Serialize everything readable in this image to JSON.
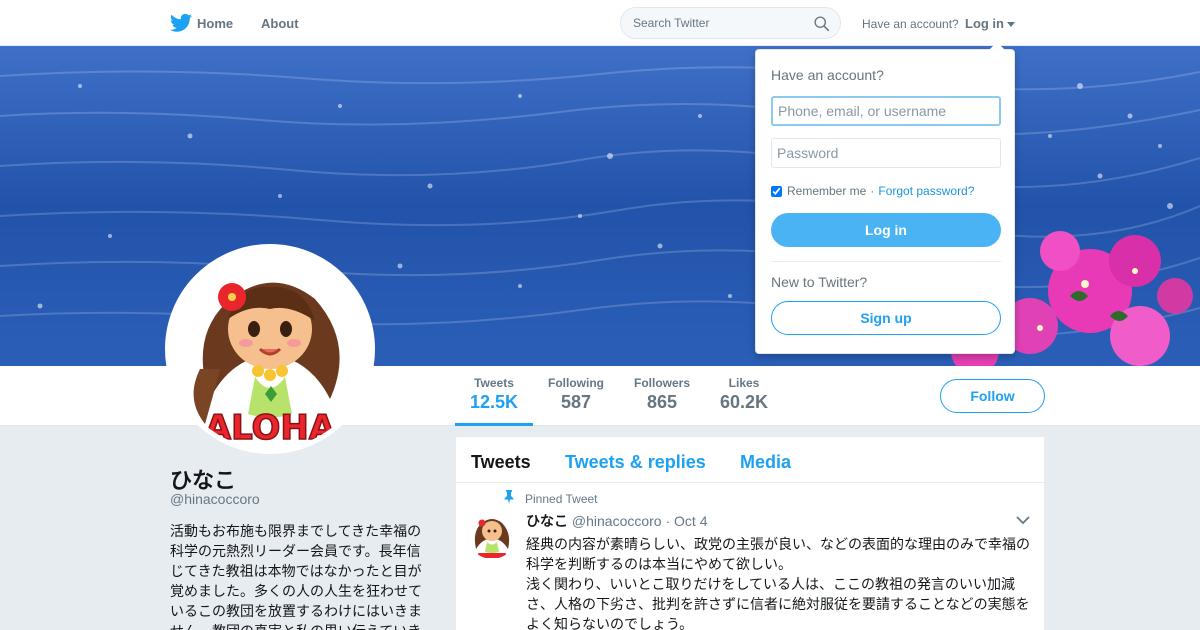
{
  "nav": {
    "home_label": "Home",
    "about_label": "About",
    "search_placeholder": "Search Twitter",
    "have_account": "Have an account?",
    "login_label": "Log in"
  },
  "profile": {
    "name": "ひなこ",
    "handle": "@hinacoccoro",
    "bio": "活動もお布施も限界までしてきた幸福の科学の元熱烈リーダー会員です。長年信じてきた教祖は本物ではなかったと目が覚めました。多くの人の人生を狂わせているこの教団を放置するわけにはいきません。教団の真実と私の思い伝えていき",
    "avatar_text": "ALOHA"
  },
  "stats": [
    {
      "label": "Tweets",
      "value": "12.5K"
    },
    {
      "label": "Following",
      "value": "587"
    },
    {
      "label": "Followers",
      "value": "865"
    },
    {
      "label": "Likes",
      "value": "60.2K"
    }
  ],
  "follow_label": "Follow",
  "timeline": {
    "tabs": [
      "Tweets",
      "Tweets & replies",
      "Media"
    ],
    "pinned_label": "Pinned Tweet",
    "tweet": {
      "name": "ひなこ",
      "handle": "@hinacoccoro",
      "dot": "·",
      "time": "Oct 4",
      "paragraph1": "経典の内容が素晴らしい、政党の主張が良い、などの表面的な理由のみで幸福の科学を判断するのは本当にやめて欲しい。",
      "paragraph2": "浅く関わり、いいとこ取りだけをしている人は、ここの教祖の発言のいい加減さ、人格の下劣さ、批判を許さずに信者に絶対服従を要請することなどの実態をよく知らないのでしょう。"
    }
  },
  "login_dropdown": {
    "title": "Have an account?",
    "username_placeholder": "Phone, email, or username",
    "password_placeholder": "Password",
    "remember_label": "Remember me",
    "separator": "·",
    "forgot_label": "Forgot password?",
    "login_button": "Log in",
    "new_label": "New to Twitter?",
    "signup_button": "Sign up"
  },
  "colors": {
    "accent": "#1da1f2",
    "login_button": "#4ab3f4",
    "banner_ocean": "#2759b2",
    "flowers": "#e83ab7"
  },
  "icons": [
    "twitter-bird-icon",
    "search-icon",
    "caret-down-icon",
    "pin-icon",
    "chevron-down-icon"
  ]
}
